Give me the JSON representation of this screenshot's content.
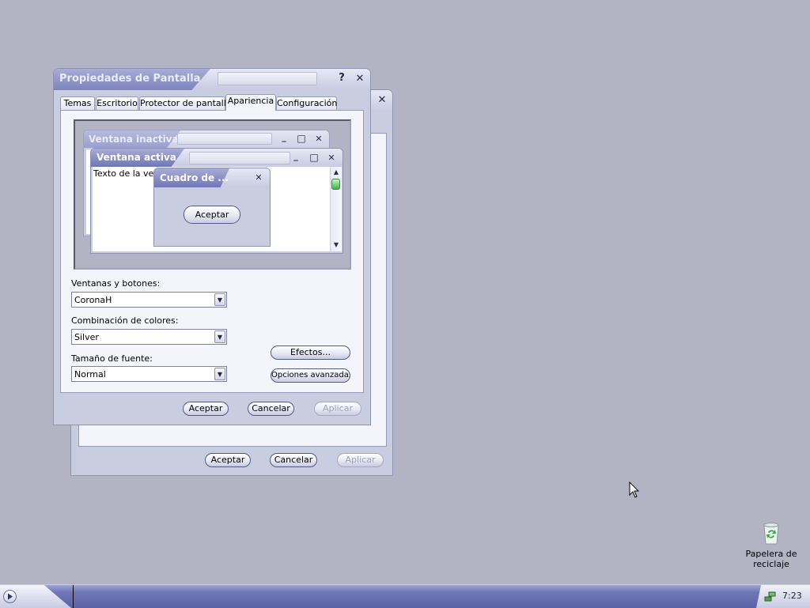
{
  "desktop": {
    "recycle_bin_label_line1": "Papelera de",
    "recycle_bin_label_line2": "reciclaje"
  },
  "back_window": {
    "accept_label": "Aceptar",
    "cancel_label": "Cancelar",
    "apply_label": "Aplicar",
    "close_symbol": "✕"
  },
  "dialog": {
    "title": "Propiedades de Pantalla",
    "help_symbol": "?",
    "close_symbol": "✕",
    "tabs": [
      {
        "label": "Temas"
      },
      {
        "label": "Escritorio"
      },
      {
        "label": "Protector de pantalla"
      },
      {
        "label": "Apariencia"
      },
      {
        "label": "Configuración"
      }
    ],
    "active_tab": "Apariencia",
    "preview": {
      "inactive_title": "Ventana inactiva",
      "active_title": "Ventana activa",
      "window_text": "Texto de la ventana",
      "message_title": "Cuadro de ...",
      "message_button": "Aceptar",
      "min_symbol": "_",
      "max_symbol": "□",
      "close_symbol": "✕"
    },
    "windows_buttons_label": "Ventanas y botones:",
    "windows_buttons_value": "CoronaH",
    "color_scheme_label": "Combinación de colores:",
    "color_scheme_value": "Silver",
    "font_size_label": "Tamaño de fuente:",
    "font_size_value": "Normal",
    "effects_button": "Efectos...",
    "advanced_button": "Opciones avanzadas",
    "accept_label": "Aceptar",
    "cancel_label": "Cancelar",
    "apply_label": "Aplicar"
  },
  "taskbar": {
    "clock": "7:23"
  },
  "colors": {
    "desktop": "#b3b4c3",
    "window_body": "#c9cde0",
    "title_accent": "#7d84bd",
    "taskbar": "#5b63a6"
  }
}
